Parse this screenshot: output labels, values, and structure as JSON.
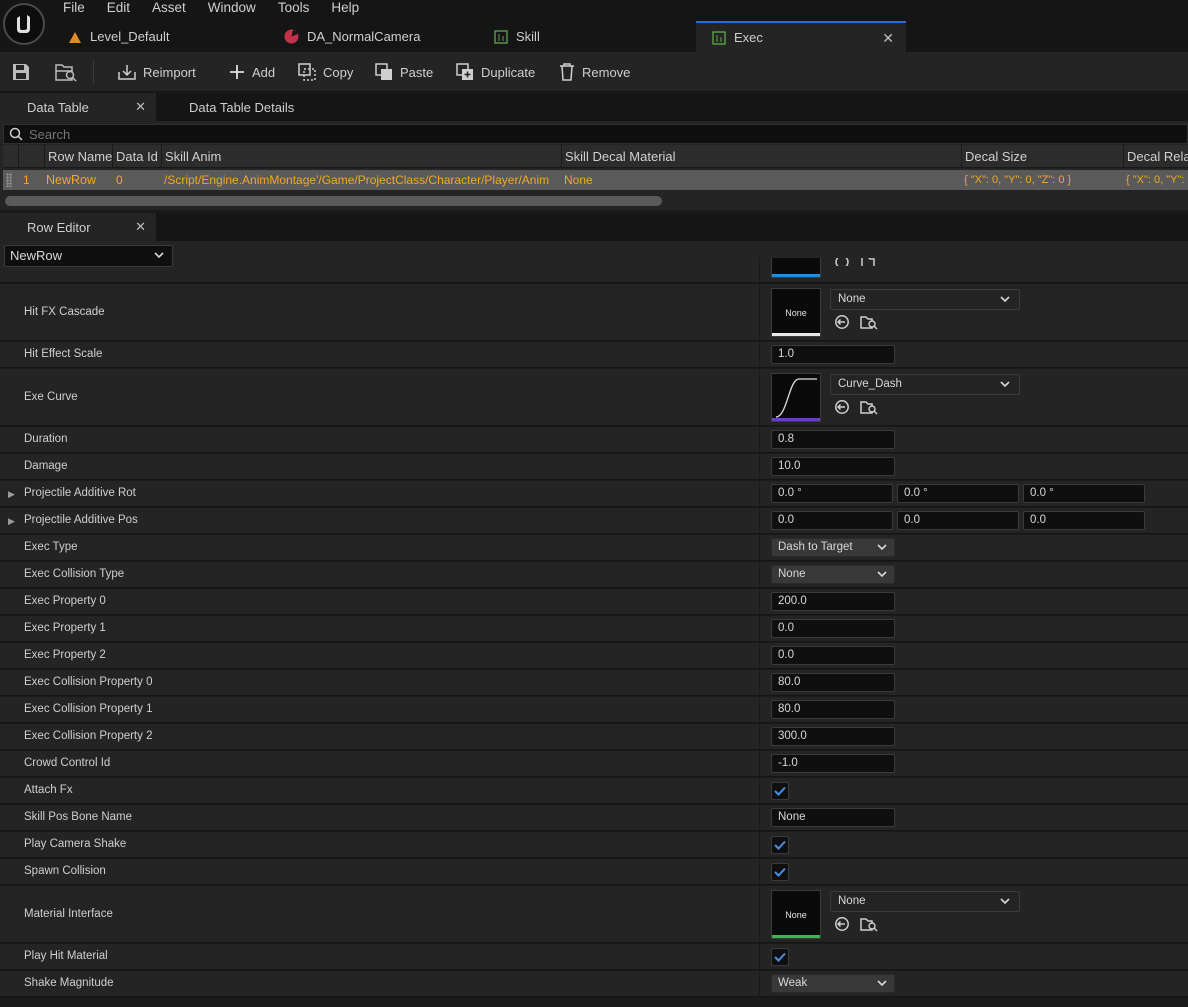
{
  "menu": [
    "File",
    "Edit",
    "Asset",
    "Window",
    "Tools",
    "Help"
  ],
  "doc_tabs": [
    {
      "label": "Level_Default",
      "icon": "level-icon"
    },
    {
      "label": "DA_NormalCamera",
      "icon": "data-asset-icon"
    },
    {
      "label": "Skill",
      "icon": "data-table-icon"
    },
    {
      "label": "Exec",
      "icon": "data-table-icon",
      "active": true
    }
  ],
  "toolbar": {
    "reimport": "Reimport",
    "add": "Add",
    "copy": "Copy",
    "paste": "Paste",
    "duplicate": "Duplicate",
    "remove": "Remove"
  },
  "panel_tabs": {
    "data_table": "Data Table",
    "details": "Data Table Details"
  },
  "search": {
    "placeholder": "Search"
  },
  "table": {
    "columns": [
      "Row Name",
      "Data Id",
      "Skill Anim",
      "Skill Decal Material",
      "Decal Size",
      "Decal Rela"
    ],
    "rows": [
      {
        "index": "1",
        "row_name": "NewRow",
        "data_id": "0",
        "skill_anim": "/Script/Engine.AnimMontage'/Game/ProjectClass/Character/Player/Anim",
        "skill_decal_material": "None",
        "decal_size": "{ \"X\": 0, \"Y\": 0, \"Z\": 0 }",
        "decal_rela": "{ \"X\": 0, \"Y\":"
      }
    ]
  },
  "row_editor": {
    "tab": "Row Editor",
    "selected_row": "NewRow",
    "props": {
      "hit_fx_cascade": {
        "label": "Hit FX Cascade",
        "thumb": "None",
        "value": "None"
      },
      "hit_effect_scale": {
        "label": "Hit Effect Scale",
        "value": "1.0"
      },
      "exe_curve": {
        "label": "Exe Curve",
        "value": "Curve_Dash"
      },
      "duration": {
        "label": "Duration",
        "value": "0.8"
      },
      "damage": {
        "label": "Damage",
        "value": "10.0"
      },
      "proj_rot": {
        "label": "Projectile Additive Rot",
        "values": [
          "0.0 °",
          "0.0 °",
          "0.0 °"
        ]
      },
      "proj_pos": {
        "label": "Projectile Additive Pos",
        "values": [
          "0.0",
          "0.0",
          "0.0"
        ]
      },
      "exec_type": {
        "label": "Exec Type",
        "value": "Dash to Target"
      },
      "exec_collision_type": {
        "label": "Exec Collision Type",
        "value": "None"
      },
      "exec_prop_0": {
        "label": "Exec Property 0",
        "value": "200.0"
      },
      "exec_prop_1": {
        "label": "Exec Property 1",
        "value": "0.0"
      },
      "exec_prop_2": {
        "label": "Exec Property 2",
        "value": "0.0"
      },
      "exec_col_prop_0": {
        "label": "Exec Collision Property 0",
        "value": "80.0"
      },
      "exec_col_prop_1": {
        "label": "Exec Collision Property 1",
        "value": "80.0"
      },
      "exec_col_prop_2": {
        "label": "Exec Collision Property 2",
        "value": "300.0"
      },
      "crowd_control_id": {
        "label": "Crowd Control Id",
        "value": "-1.0"
      },
      "attach_fx": {
        "label": "Attach Fx",
        "checked": true
      },
      "skill_pos_bone": {
        "label": "Skill Pos Bone Name",
        "value": "None"
      },
      "play_camera_shake": {
        "label": "Play Camera Shake",
        "checked": true
      },
      "spawn_collision": {
        "label": "Spawn Collision",
        "checked": true
      },
      "material_interface": {
        "label": "Material Interface",
        "thumb": "None",
        "value": "None"
      },
      "play_hit_material": {
        "label": "Play Hit Material",
        "checked": true
      },
      "shake_magnitude": {
        "label": "Shake Magnitude",
        "value": "Weak"
      }
    }
  },
  "colors": {
    "accent_blue": "#2d6ad6",
    "row_text": "#f0a828",
    "checkmark": "#4a90e2",
    "cascade_bar": "#1e8fd6",
    "curve_bar": "#6a3fc7",
    "material_bar": "#3fb34f"
  }
}
